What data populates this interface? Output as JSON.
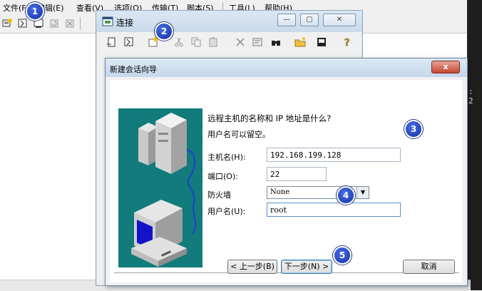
{
  "menubar": {
    "items": [
      "文件(F)",
      "编辑(E)",
      "查看(V)",
      "选项(O)",
      "传输(T)",
      "脚本(S)",
      "工具(L)",
      "帮助(H)"
    ]
  },
  "terminal_snippet": ": 2",
  "connect_window": {
    "title": "连接"
  },
  "wizard": {
    "title": "新建会话向导",
    "close_label": "x",
    "heading": "远程主机的名称和 IP 地址是什么?",
    "subheading": "用户名可以留空。",
    "hostname": {
      "label": "主机名(H):",
      "value": "192.168.199.128"
    },
    "port": {
      "label": "端口(O):",
      "value": "22"
    },
    "firewall": {
      "label": "防火墙",
      "value": "None"
    },
    "username": {
      "label": "用户名(U):",
      "value": "root"
    },
    "buttons": {
      "back": "< 上一步(B)",
      "next": "下一步(N) >",
      "cancel": "取消"
    }
  },
  "badges": [
    "1",
    "2",
    "3",
    "4",
    "5"
  ]
}
